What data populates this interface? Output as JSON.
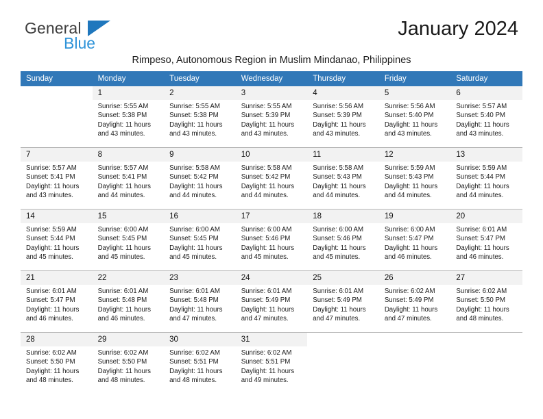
{
  "brand": {
    "name_part1": "General",
    "name_part2": "Blue",
    "accent_color": "#2e93d8",
    "triangle_color": "#1f77bd"
  },
  "header": {
    "month_title": "January 2024",
    "location": "Rimpeso, Autonomous Region in Muslim Mindanao, Philippines",
    "header_bg": "#3178b8"
  },
  "weekday_headers": [
    "Sunday",
    "Monday",
    "Tuesday",
    "Wednesday",
    "Thursday",
    "Friday",
    "Saturday"
  ],
  "weeks": [
    {
      "days": [
        {
          "num": "",
          "sunrise": "",
          "sunset": "",
          "daylight_a": "",
          "daylight_b": "",
          "empty": true
        },
        {
          "num": "1",
          "sunrise": "Sunrise: 5:55 AM",
          "sunset": "Sunset: 5:38 PM",
          "daylight_a": "Daylight: 11 hours",
          "daylight_b": "and 43 minutes."
        },
        {
          "num": "2",
          "sunrise": "Sunrise: 5:55 AM",
          "sunset": "Sunset: 5:38 PM",
          "daylight_a": "Daylight: 11 hours",
          "daylight_b": "and 43 minutes."
        },
        {
          "num": "3",
          "sunrise": "Sunrise: 5:55 AM",
          "sunset": "Sunset: 5:39 PM",
          "daylight_a": "Daylight: 11 hours",
          "daylight_b": "and 43 minutes."
        },
        {
          "num": "4",
          "sunrise": "Sunrise: 5:56 AM",
          "sunset": "Sunset: 5:39 PM",
          "daylight_a": "Daylight: 11 hours",
          "daylight_b": "and 43 minutes."
        },
        {
          "num": "5",
          "sunrise": "Sunrise: 5:56 AM",
          "sunset": "Sunset: 5:40 PM",
          "daylight_a": "Daylight: 11 hours",
          "daylight_b": "and 43 minutes."
        },
        {
          "num": "6",
          "sunrise": "Sunrise: 5:57 AM",
          "sunset": "Sunset: 5:40 PM",
          "daylight_a": "Daylight: 11 hours",
          "daylight_b": "and 43 minutes."
        }
      ]
    },
    {
      "days": [
        {
          "num": "7",
          "sunrise": "Sunrise: 5:57 AM",
          "sunset": "Sunset: 5:41 PM",
          "daylight_a": "Daylight: 11 hours",
          "daylight_b": "and 43 minutes."
        },
        {
          "num": "8",
          "sunrise": "Sunrise: 5:57 AM",
          "sunset": "Sunset: 5:41 PM",
          "daylight_a": "Daylight: 11 hours",
          "daylight_b": "and 44 minutes."
        },
        {
          "num": "9",
          "sunrise": "Sunrise: 5:58 AM",
          "sunset": "Sunset: 5:42 PM",
          "daylight_a": "Daylight: 11 hours",
          "daylight_b": "and 44 minutes."
        },
        {
          "num": "10",
          "sunrise": "Sunrise: 5:58 AM",
          "sunset": "Sunset: 5:42 PM",
          "daylight_a": "Daylight: 11 hours",
          "daylight_b": "and 44 minutes."
        },
        {
          "num": "11",
          "sunrise": "Sunrise: 5:58 AM",
          "sunset": "Sunset: 5:43 PM",
          "daylight_a": "Daylight: 11 hours",
          "daylight_b": "and 44 minutes."
        },
        {
          "num": "12",
          "sunrise": "Sunrise: 5:59 AM",
          "sunset": "Sunset: 5:43 PM",
          "daylight_a": "Daylight: 11 hours",
          "daylight_b": "and 44 minutes."
        },
        {
          "num": "13",
          "sunrise": "Sunrise: 5:59 AM",
          "sunset": "Sunset: 5:44 PM",
          "daylight_a": "Daylight: 11 hours",
          "daylight_b": "and 44 minutes."
        }
      ]
    },
    {
      "days": [
        {
          "num": "14",
          "sunrise": "Sunrise: 5:59 AM",
          "sunset": "Sunset: 5:44 PM",
          "daylight_a": "Daylight: 11 hours",
          "daylight_b": "and 45 minutes."
        },
        {
          "num": "15",
          "sunrise": "Sunrise: 6:00 AM",
          "sunset": "Sunset: 5:45 PM",
          "daylight_a": "Daylight: 11 hours",
          "daylight_b": "and 45 minutes."
        },
        {
          "num": "16",
          "sunrise": "Sunrise: 6:00 AM",
          "sunset": "Sunset: 5:45 PM",
          "daylight_a": "Daylight: 11 hours",
          "daylight_b": "and 45 minutes."
        },
        {
          "num": "17",
          "sunrise": "Sunrise: 6:00 AM",
          "sunset": "Sunset: 5:46 PM",
          "daylight_a": "Daylight: 11 hours",
          "daylight_b": "and 45 minutes."
        },
        {
          "num": "18",
          "sunrise": "Sunrise: 6:00 AM",
          "sunset": "Sunset: 5:46 PM",
          "daylight_a": "Daylight: 11 hours",
          "daylight_b": "and 45 minutes."
        },
        {
          "num": "19",
          "sunrise": "Sunrise: 6:00 AM",
          "sunset": "Sunset: 5:47 PM",
          "daylight_a": "Daylight: 11 hours",
          "daylight_b": "and 46 minutes."
        },
        {
          "num": "20",
          "sunrise": "Sunrise: 6:01 AM",
          "sunset": "Sunset: 5:47 PM",
          "daylight_a": "Daylight: 11 hours",
          "daylight_b": "and 46 minutes."
        }
      ]
    },
    {
      "days": [
        {
          "num": "21",
          "sunrise": "Sunrise: 6:01 AM",
          "sunset": "Sunset: 5:47 PM",
          "daylight_a": "Daylight: 11 hours",
          "daylight_b": "and 46 minutes."
        },
        {
          "num": "22",
          "sunrise": "Sunrise: 6:01 AM",
          "sunset": "Sunset: 5:48 PM",
          "daylight_a": "Daylight: 11 hours",
          "daylight_b": "and 46 minutes."
        },
        {
          "num": "23",
          "sunrise": "Sunrise: 6:01 AM",
          "sunset": "Sunset: 5:48 PM",
          "daylight_a": "Daylight: 11 hours",
          "daylight_b": "and 47 minutes."
        },
        {
          "num": "24",
          "sunrise": "Sunrise: 6:01 AM",
          "sunset": "Sunset: 5:49 PM",
          "daylight_a": "Daylight: 11 hours",
          "daylight_b": "and 47 minutes."
        },
        {
          "num": "25",
          "sunrise": "Sunrise: 6:01 AM",
          "sunset": "Sunset: 5:49 PM",
          "daylight_a": "Daylight: 11 hours",
          "daylight_b": "and 47 minutes."
        },
        {
          "num": "26",
          "sunrise": "Sunrise: 6:02 AM",
          "sunset": "Sunset: 5:49 PM",
          "daylight_a": "Daylight: 11 hours",
          "daylight_b": "and 47 minutes."
        },
        {
          "num": "27",
          "sunrise": "Sunrise: 6:02 AM",
          "sunset": "Sunset: 5:50 PM",
          "daylight_a": "Daylight: 11 hours",
          "daylight_b": "and 48 minutes."
        }
      ]
    },
    {
      "days": [
        {
          "num": "28",
          "sunrise": "Sunrise: 6:02 AM",
          "sunset": "Sunset: 5:50 PM",
          "daylight_a": "Daylight: 11 hours",
          "daylight_b": "and 48 minutes."
        },
        {
          "num": "29",
          "sunrise": "Sunrise: 6:02 AM",
          "sunset": "Sunset: 5:50 PM",
          "daylight_a": "Daylight: 11 hours",
          "daylight_b": "and 48 minutes."
        },
        {
          "num": "30",
          "sunrise": "Sunrise: 6:02 AM",
          "sunset": "Sunset: 5:51 PM",
          "daylight_a": "Daylight: 11 hours",
          "daylight_b": "and 48 minutes."
        },
        {
          "num": "31",
          "sunrise": "Sunrise: 6:02 AM",
          "sunset": "Sunset: 5:51 PM",
          "daylight_a": "Daylight: 11 hours",
          "daylight_b": "and 49 minutes."
        },
        {
          "num": "",
          "sunrise": "",
          "sunset": "",
          "daylight_a": "",
          "daylight_b": "",
          "empty": true
        },
        {
          "num": "",
          "sunrise": "",
          "sunset": "",
          "daylight_a": "",
          "daylight_b": "",
          "empty": true
        },
        {
          "num": "",
          "sunrise": "",
          "sunset": "",
          "daylight_a": "",
          "daylight_b": "",
          "empty": true
        }
      ]
    }
  ]
}
